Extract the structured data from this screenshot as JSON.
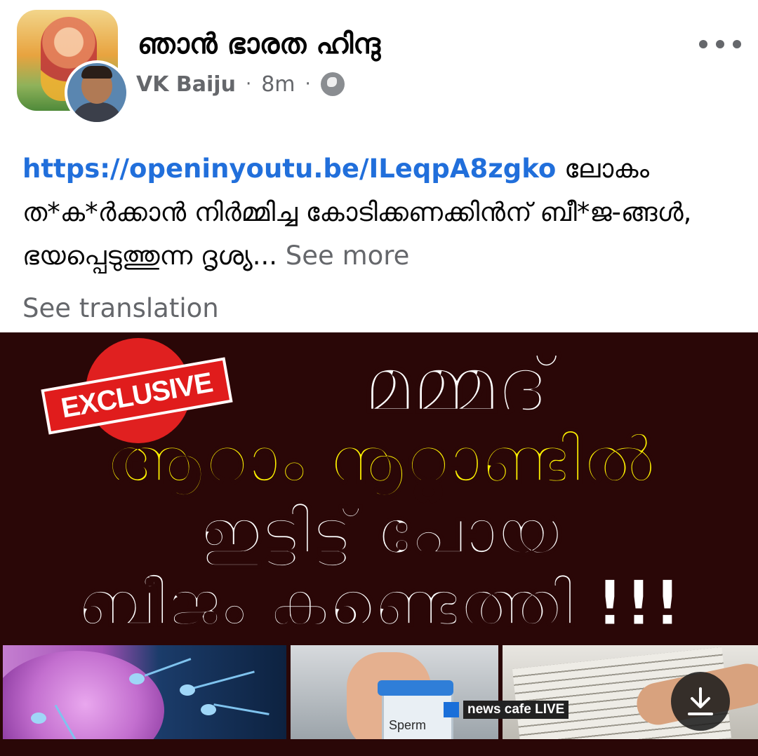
{
  "post": {
    "group_name": "ഞാൻ ഭാരത ഹിന്ദു",
    "author": "VK Baiju",
    "time": "8m",
    "separator": "·",
    "privacy_icon": "globe-icon",
    "more_icon": "more-horizontal-icon",
    "link": "https://openinyoutu.be/ILeqpA8zgko",
    "text": "ലോകം ത*ക*ർക്കാൻ നിർമ്മിച്ച കോടിക്കണക്കിൻന് ബീ*ജ-ങ്ങൾ, ഭയപ്പെടുത്തുന്ന ദൃശ്യ...",
    "see_more": "See more",
    "see_translation": "See translation"
  },
  "thumbnail": {
    "badge": "EXCLUSIVE",
    "line1": "മമ്മദ്",
    "line2": "ആറാം നൂറ്റാണ്ടിൽ",
    "line3": "ഇട്ടിട്ട് പോയ",
    "line4": "ബീജം കണ്ടെത്തി !!!",
    "cup_label": "Sperm",
    "channel": "news cafe LIVE",
    "download_icon": "download-icon",
    "colors": {
      "background": "#2a0707",
      "headline_yellow": "#fff200",
      "badge_red": "#e01c1c"
    }
  }
}
